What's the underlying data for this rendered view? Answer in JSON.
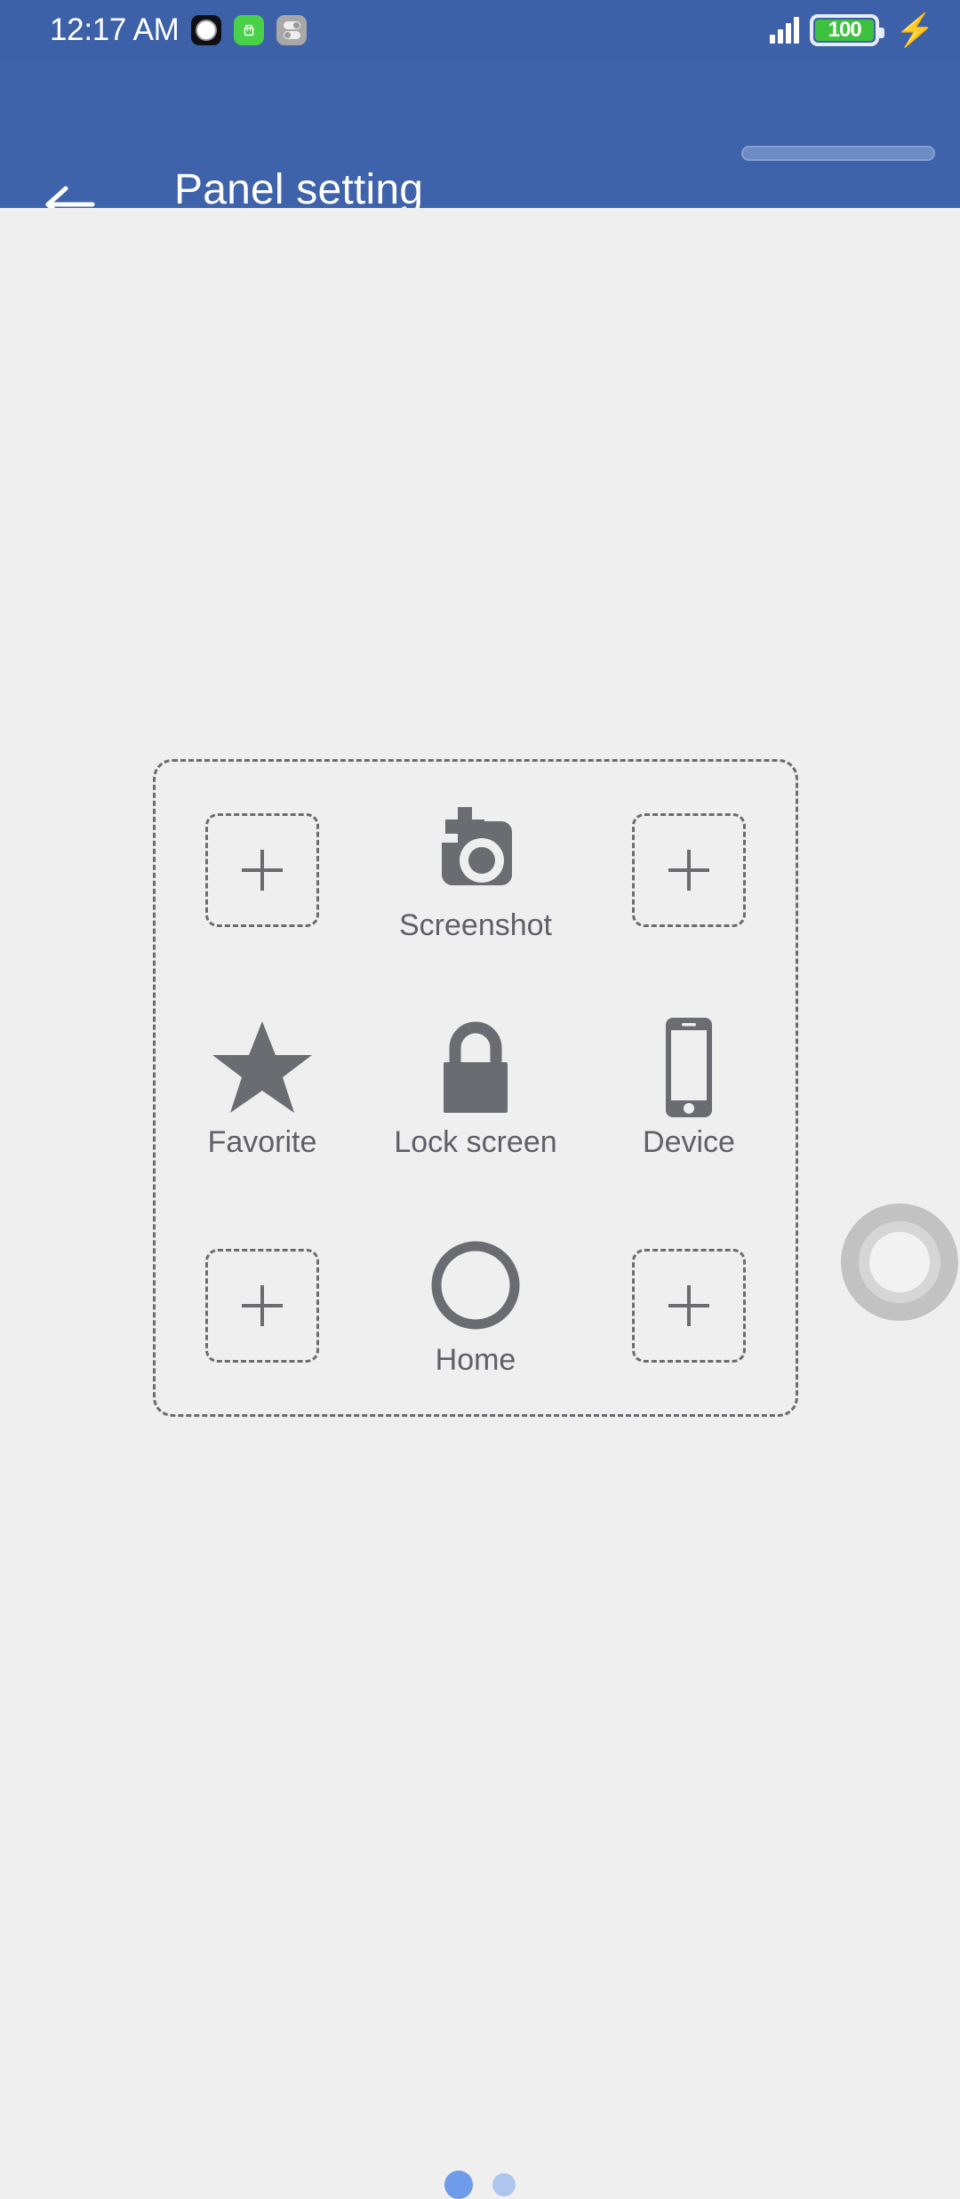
{
  "status_bar": {
    "time": "12:17 AM",
    "notifications": [
      {
        "name": "camera-capture-icon",
        "style": "black"
      },
      {
        "name": "android-robot-icon",
        "style": "green"
      },
      {
        "name": "toggles-settings-icon",
        "style": "grey"
      }
    ],
    "signal_icon": "cellular-signal-icon",
    "signal_bars": 4,
    "battery_level": "100",
    "battery_color": "#3DC13F",
    "charging_icon": "charging-bolt-icon"
  },
  "app_bar": {
    "back_icon": "back-arrow-icon",
    "title": "Panel setting",
    "background": "#3F63AB",
    "pill_indicator": "header-pill-indicator"
  },
  "panel": {
    "border_style": "dashed",
    "cells": [
      {
        "pos": "r1c1",
        "type": "empty",
        "icon": "plus-icon",
        "label": ""
      },
      {
        "pos": "r1c2",
        "type": "filled",
        "icon": "screenshot-icon",
        "label": "Screenshot"
      },
      {
        "pos": "r1c3",
        "type": "empty",
        "icon": "plus-icon",
        "label": ""
      },
      {
        "pos": "r2c1",
        "type": "filled",
        "icon": "star-icon",
        "label": "Favorite"
      },
      {
        "pos": "r2c2",
        "type": "filled",
        "icon": "lock-icon",
        "label": "Lock screen"
      },
      {
        "pos": "r2c3",
        "type": "filled",
        "icon": "smartphone-icon",
        "label": "Device"
      },
      {
        "pos": "r3c1",
        "type": "empty",
        "icon": "plus-icon",
        "label": ""
      },
      {
        "pos": "r3c2",
        "type": "filled",
        "icon": "home-circle-icon",
        "label": "Home"
      },
      {
        "pos": "r3c3",
        "type": "empty",
        "icon": "plus-icon",
        "label": ""
      }
    ],
    "icon_color": "#6B6B72",
    "label_color": "#5F5F66"
  },
  "floating_ball": {
    "name": "assistive-touch-ball",
    "color": "#C2C2C2"
  },
  "pagination": {
    "total_pages": 2,
    "current_page": 1,
    "active_color": "#6E9CEA",
    "inactive_color": "#AEC5EE"
  }
}
